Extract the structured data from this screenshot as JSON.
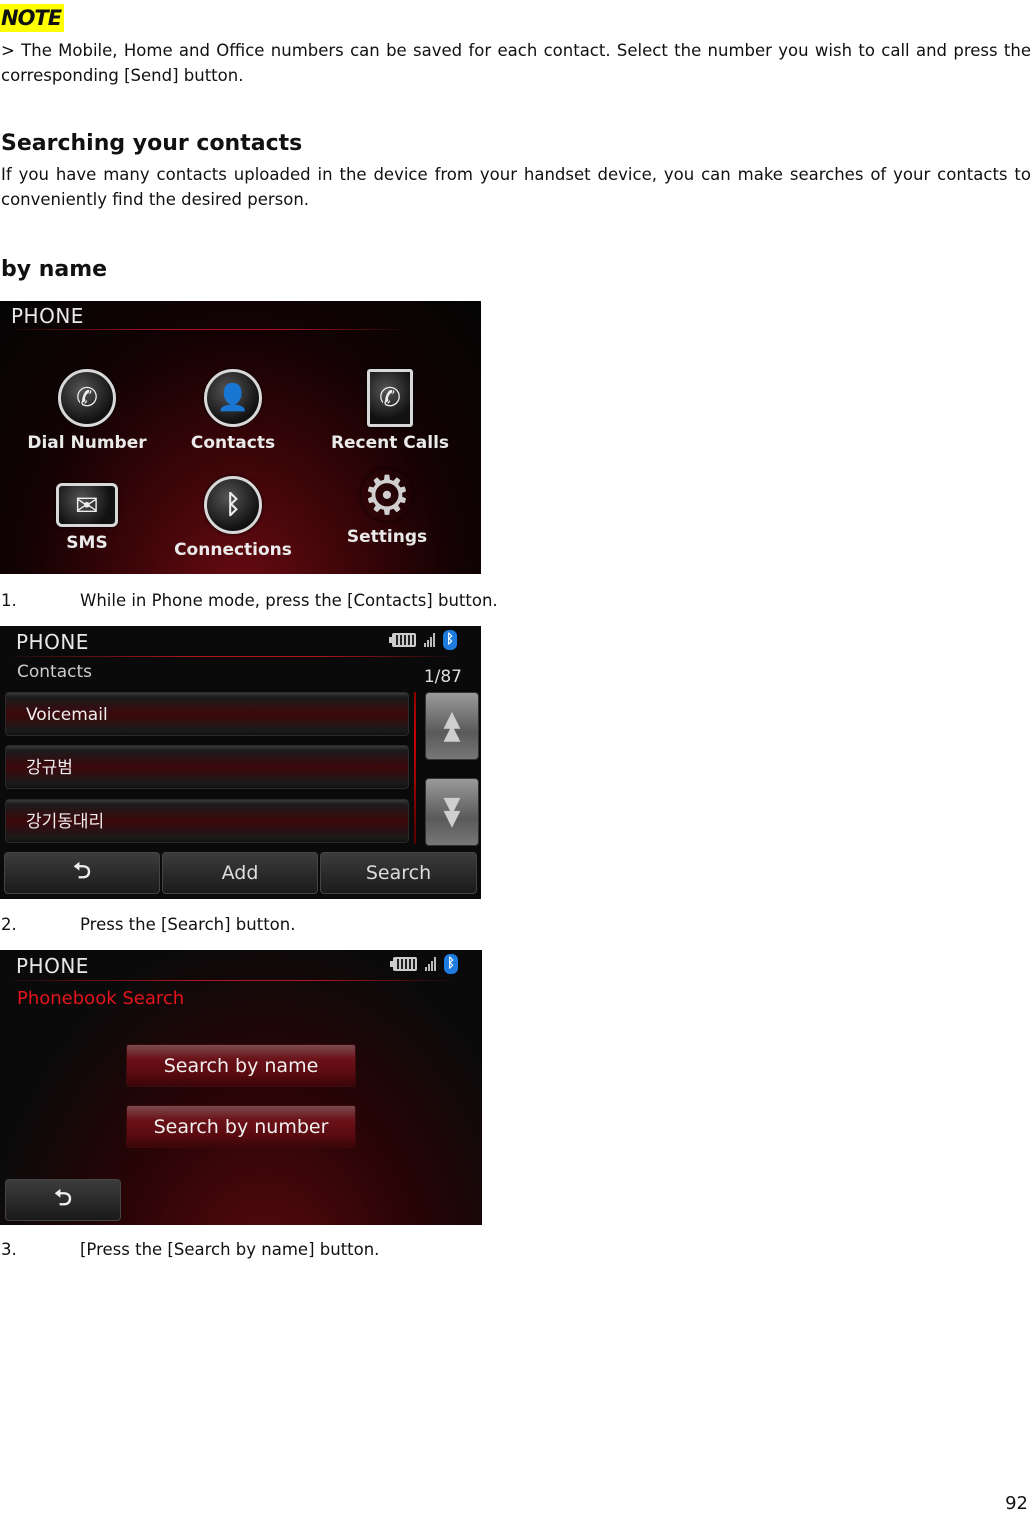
{
  "note": {
    "tag": "NOTE",
    "text": "> The Mobile, Home and Office numbers can be saved for each contact. Select the number you wish to call and press the corresponding [Send] button."
  },
  "section": {
    "title": "Searching your contacts",
    "text": "If you have many contacts uploaded in the device from your handset device, you can make searches of your contacts to conveniently find the desired person."
  },
  "subsection": {
    "title": "by name"
  },
  "screen1": {
    "title": "PHONE",
    "items": [
      {
        "label": "Dial Number",
        "icon": "phone-icon"
      },
      {
        "label": "Contacts",
        "icon": "contacts-icon"
      },
      {
        "label": "Recent Calls",
        "icon": "recent-calls-icon"
      },
      {
        "label": "SMS",
        "icon": "envelope-icon"
      },
      {
        "label": "Connections",
        "icon": "bluetooth-icon"
      },
      {
        "label": "Settings",
        "icon": "gear-icon"
      }
    ]
  },
  "step1": {
    "num": "1.",
    "text": "While in Phone mode, press the [Contacts] button."
  },
  "screen2": {
    "title": "PHONE",
    "subtitle": "Contacts",
    "counter": "1/87",
    "contacts": [
      "Voicemail",
      "강규범",
      "강기동대리"
    ],
    "buttons": {
      "back": "⮌",
      "add": "Add",
      "search": "Search"
    }
  },
  "step2": {
    "num": "2.",
    "text": "Press the [Search] button."
  },
  "screen3": {
    "title": "PHONE",
    "subtitle": "Phonebook Search",
    "search_by_name": "Search by name",
    "search_by_number": "Search by number",
    "back": "⮌"
  },
  "step3": {
    "num": "3.",
    "text": "[Press the [Search by name] button."
  },
  "page_number": "92"
}
